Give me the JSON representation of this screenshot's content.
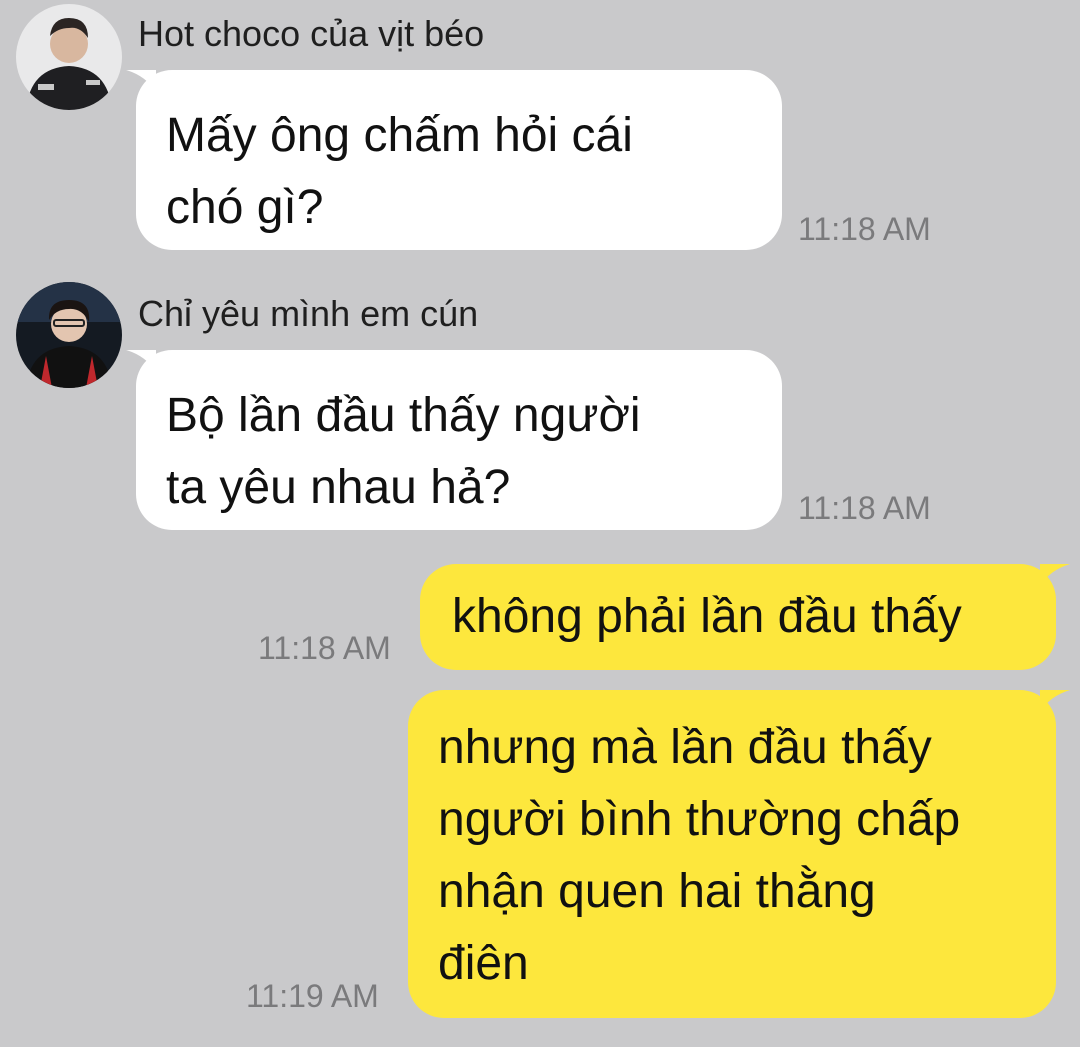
{
  "colors": {
    "background": "#c9c9cb",
    "incoming_bubble": "#ffffff",
    "outgoing_bubble": "#fde73d",
    "timestamp": "#7a7a7c"
  },
  "messages": [
    {
      "direction": "incoming",
      "sender": "Hot choco của vịt béo",
      "avatar_icon": "user-avatar-icon",
      "lines": [
        "Mấy ông chấm hỏi cái",
        "chó gì?"
      ],
      "time": "11:18 AM"
    },
    {
      "direction": "incoming",
      "sender": "Chỉ yêu mình em cún",
      "avatar_icon": "user-avatar-icon",
      "lines": [
        "Bộ lần đầu thấy người",
        "ta yêu nhau hả?"
      ],
      "time": "11:18 AM"
    },
    {
      "direction": "outgoing",
      "lines": [
        "không phải lần đầu thấy"
      ],
      "time": "11:18 AM"
    },
    {
      "direction": "outgoing",
      "lines": [
        "nhưng mà lần đầu thấy",
        "người bình thường chấp",
        "nhận quen hai thằng",
        "điên"
      ],
      "time": "11:19 AM"
    }
  ]
}
